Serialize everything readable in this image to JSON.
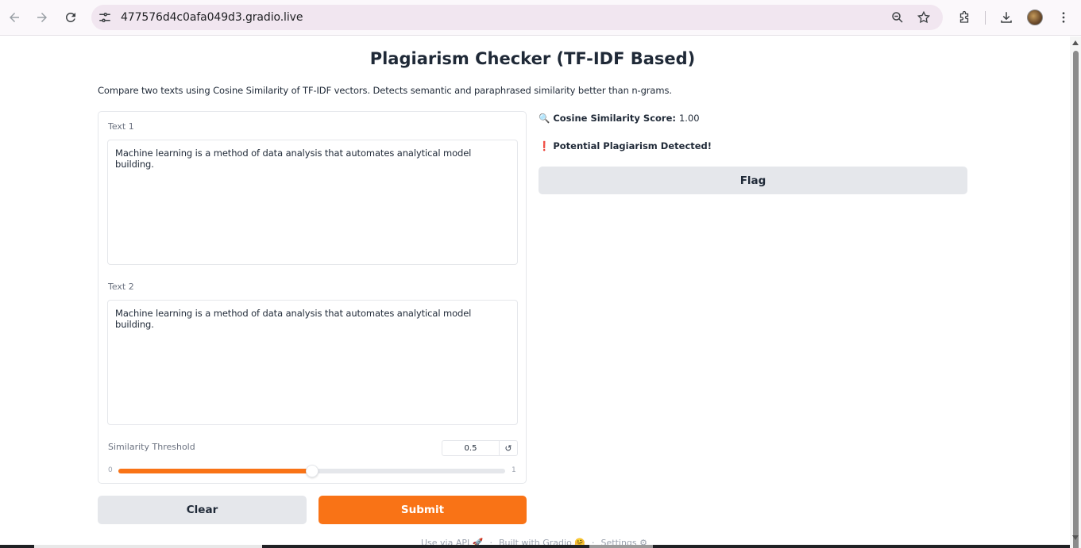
{
  "browser": {
    "url": "477576d4c0afa049d3.gradio.live"
  },
  "page": {
    "title": "Plagiarism Checker (TF-IDF Based)",
    "description": "Compare two texts using Cosine Similarity of TF-IDF vectors. Detects semantic and paraphrased similarity better than n-grams."
  },
  "inputs": {
    "text1_label": "Text 1",
    "text1_value": "Machine learning is a method of data analysis that automates analytical model building.",
    "text2_label": "Text 2",
    "text2_value": "Machine learning is a method of data analysis that automates analytical model building.",
    "threshold_label": "Similarity Threshold",
    "threshold_value": "0.5",
    "threshold_fraction": 0.5,
    "threshold_min": "0",
    "threshold_max": "1",
    "reset_icon": "↺"
  },
  "buttons": {
    "clear_label": "Clear",
    "submit_label": "Submit",
    "flag_label": "Flag"
  },
  "output": {
    "score_icon": "🔍",
    "score_label": "Cosine Similarity Score:",
    "score_value": "1.00",
    "verdict_icon": "❗",
    "verdict": "Potential Plagiarism Detected!"
  },
  "footer": {
    "api_label": "Use via API",
    "api_icon": "🚀",
    "sep": "·",
    "built_label": "Built with Gradio",
    "built_icon": "🤗",
    "settings_label": "Settings",
    "settings_icon": "⚙"
  },
  "colors": {
    "accent": "#f97316",
    "secondary": "#e5e7eb"
  }
}
